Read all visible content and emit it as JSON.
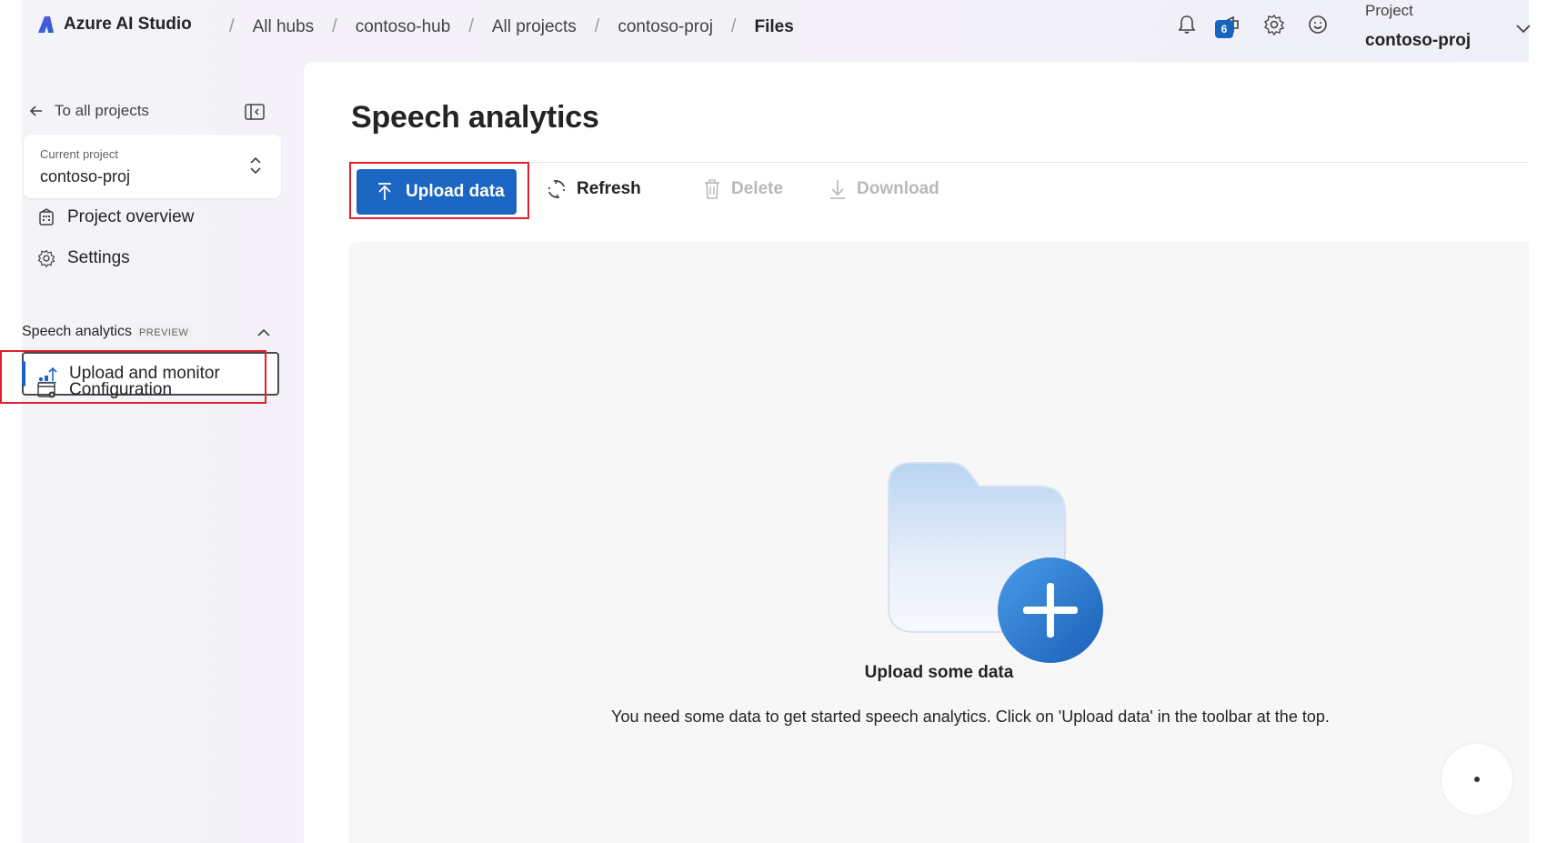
{
  "topbar": {
    "brand": "Azure AI Studio",
    "breadcrumbs": [
      "All hubs",
      "contoso-hub",
      "All projects",
      "contoso-proj"
    ],
    "current_crumb": "Files",
    "notification_count": "6",
    "project_label": "Project",
    "project_value": "contoso-proj"
  },
  "sidebar": {
    "back_link": "To all projects",
    "current_project_label": "Current project",
    "current_project_value": "contoso-proj",
    "items": [
      {
        "label": "Project overview",
        "icon": "building-icon"
      },
      {
        "label": "Settings",
        "icon": "gear-icon"
      }
    ],
    "section": {
      "label": "Speech analytics",
      "badge": "PREVIEW",
      "items": [
        {
          "label": "Upload and monitor",
          "icon": "upload-monitor-icon",
          "selected": true
        },
        {
          "label": "Configuration",
          "icon": "configuration-icon"
        }
      ]
    }
  },
  "main": {
    "title": "Speech analytics",
    "toolbar": {
      "upload": "Upload data",
      "refresh": "Refresh",
      "delete": "Delete",
      "download": "Download"
    },
    "empty_state": {
      "title": "Upload some data",
      "description": "You need some data to get started speech analytics. Click on 'Upload data' in the toolbar at the top."
    }
  },
  "colors": {
    "accent": "#1a66c2",
    "highlight": "#e0202c"
  }
}
